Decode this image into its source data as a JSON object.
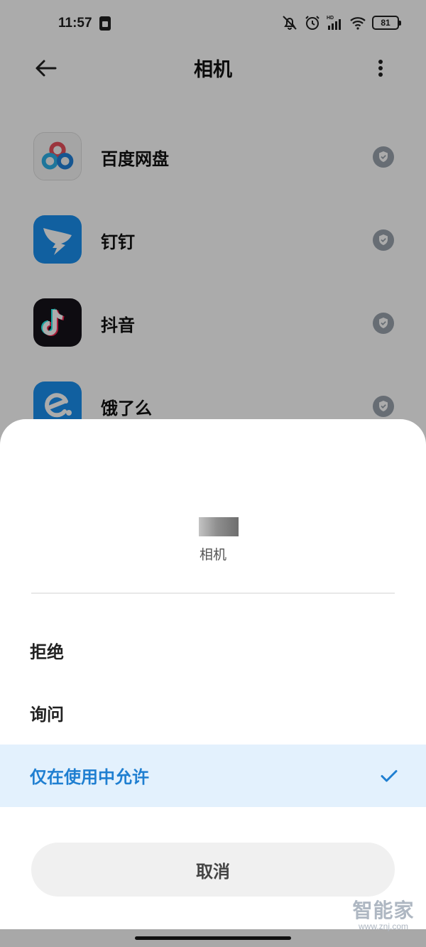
{
  "status_bar": {
    "time": "11:57",
    "battery": "81",
    "icons": [
      "sim-icon",
      "mute-icon",
      "alarm-icon",
      "hd-signal-icon",
      "wifi-icon",
      "battery-icon"
    ]
  },
  "header": {
    "title": "相机",
    "icons": [
      "back-arrow-icon",
      "more-vertical-icon"
    ]
  },
  "apps": [
    {
      "name": "百度网盘",
      "icon": "baidu-netdisk-icon"
    },
    {
      "name": "钉钉",
      "icon": "dingtalk-icon"
    },
    {
      "name": "抖音",
      "icon": "douyin-icon"
    },
    {
      "name": "饿了么",
      "icon": "eleme-icon"
    }
  ],
  "sheet": {
    "title": "相机",
    "options": [
      {
        "label": "拒绝",
        "selected": false
      },
      {
        "label": "询问",
        "selected": false
      },
      {
        "label": "仅在使用中允许",
        "selected": true
      }
    ],
    "cancel_label": "取消"
  },
  "watermark": {
    "name": "智能家",
    "url": "www.znj.com"
  },
  "colors": {
    "accent": "#1f7fd1",
    "selected_bg": "#e3f1fd",
    "dim_overlay": "rgba(0,0,0,0.33)"
  }
}
